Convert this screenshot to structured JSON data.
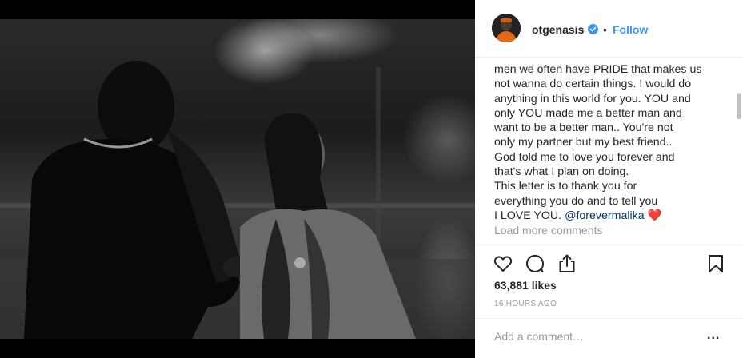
{
  "post": {
    "photo_alt": "Black and white photo of a couple",
    "header": {
      "username": "otgenasis",
      "separator": "•",
      "follow_label": "Follow",
      "avatar_icon": "avatar-icon",
      "verified_icon": "verified-badge-icon"
    },
    "caption": {
      "text": "men we often have PRIDE that makes us\nnot wanna do certain things. I would do\nanything in this world for you. YOU and\nonly YOU made me a better man and\nwant to be a better man.. You're not\nonly my partner but my best friend..\nGod told me to love you forever and\nthat's what I plan on doing.\nThis letter is to thank you for\neverything you do and to tell you\nI LOVE YOU. ",
      "mention": "@forevermalika",
      "emoji": "❤️"
    },
    "load_more_label": "Load more comments",
    "actions": {
      "like_icon": "heart-icon",
      "comment_icon": "comment-icon",
      "share_icon": "share-icon",
      "save_icon": "bookmark-icon"
    },
    "likes_label": "63,881 likes",
    "timestamp": "16 HOURS AGO",
    "comment_placeholder": "Add a comment…",
    "more_label": "..."
  },
  "colors": {
    "link": "#3897f0",
    "mention": "#003569",
    "text": "#262626",
    "muted": "#999999"
  }
}
